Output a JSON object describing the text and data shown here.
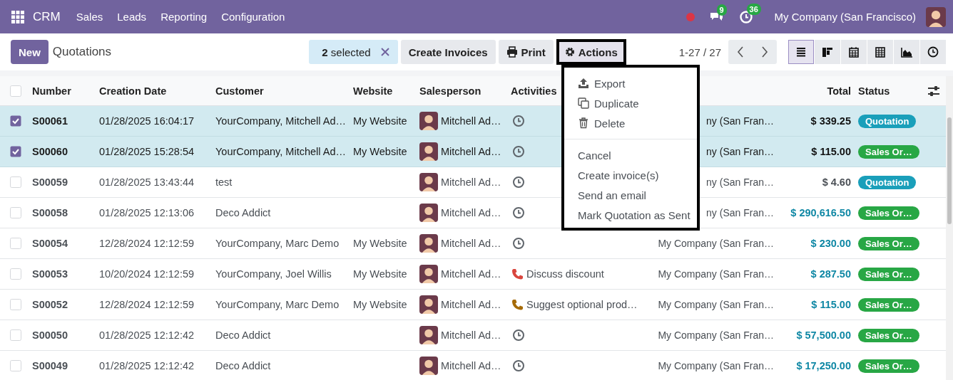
{
  "navbar": {
    "app": "CRM",
    "menus": [
      "Sales",
      "Leads",
      "Reporting",
      "Configuration"
    ],
    "messages_count": "9",
    "activities_count": "36",
    "company": "My Company (San Francisco)"
  },
  "control_panel": {
    "new_button": "New",
    "breadcrumb": "Quotations",
    "selection": "**2** selected",
    "buttons": [
      "Create Invoices",
      "Print",
      "Actions"
    ],
    "pager": "1-27 / 27",
    "views": [
      {
        "kind": "list",
        "selected": true
      },
      {
        "kind": "kanban",
        "selected": false
      },
      {
        "kind": "calendar",
        "selected": false
      },
      {
        "kind": "pivot",
        "selected": false
      },
      {
        "kind": "graph",
        "selected": false
      },
      {
        "kind": "activity",
        "selected": false
      }
    ]
  },
  "actions_menu": {
    "groups": [
      [
        {
          "kind": "export",
          "label": "Export"
        },
        {
          "kind": "duplicate",
          "label": "Duplicate"
        },
        {
          "kind": "delete",
          "label": "Delete"
        }
      ],
      [
        {
          "kind": "text",
          "label": "Cancel"
        },
        {
          "kind": "text",
          "label": "Create invoice(s)"
        },
        {
          "kind": "text",
          "label": "Send an email"
        },
        {
          "kind": "text",
          "label": "Mark Quotation as Sent"
        }
      ]
    ]
  },
  "table": {
    "all_selected": false,
    "columns": [
      "Number",
      "Creation Date",
      "Customer",
      "Website",
      "Salesperson",
      "Activities",
      "Total",
      "Status"
    ],
    "rows": [
      {
        "selected": true,
        "number": "S00061",
        "date": "01/28/2025 16:04:17",
        "customer": "YourCompany, Mitchell Ad…",
        "website": "My Website",
        "salesperson": "Mitchell Ad…",
        "activity": {
          "kind": "clock"
        },
        "company": "ny (San Fran…",
        "total": "$ 339.25",
        "status": {
          "kind": "quotation",
          "label": "Quotation"
        }
      },
      {
        "selected": true,
        "number": "S00060",
        "date": "01/28/2025 15:28:54",
        "customer": "YourCompany, Mitchell Ad…",
        "website": "My Website",
        "salesperson": "Mitchell Ad…",
        "activity": {
          "kind": "clock"
        },
        "company": "ny (San Fran…",
        "total": "$ 115.00",
        "status": {
          "kind": "sale",
          "label": "Sales Or…"
        }
      },
      {
        "selected": false,
        "number": "S00059",
        "date": "01/28/2025 13:43:44",
        "customer": "test",
        "salesperson": "Mitchell Ad…",
        "activity": {
          "kind": "clock"
        },
        "company": "ny (San Fran…",
        "total": "$ 4.60",
        "status": {
          "kind": "quotation",
          "label": "Quotation"
        }
      },
      {
        "selected": false,
        "number": "S00058",
        "date": "01/28/2025 12:13:06",
        "customer": "Deco Addict",
        "salesperson": "Mitchell Ad…",
        "activity": {
          "kind": "clock"
        },
        "company": "ny (San Fran…",
        "total": "$ 290,616.50",
        "status": {
          "kind": "sale",
          "label": "Sales Or…"
        }
      },
      {
        "selected": false,
        "number": "S00054",
        "date": "12/28/2024 12:12:59",
        "customer": "YourCompany, Marc Demo",
        "website": "My Website",
        "salesperson": "Mitchell Ad…",
        "activity": {
          "kind": "clock"
        },
        "company": "My Company (San Fran…",
        "total": "$ 230.00",
        "status": {
          "kind": "sale",
          "label": "Sales Or…"
        }
      },
      {
        "selected": false,
        "number": "S00053",
        "date": "10/20/2024 12:12:59",
        "customer": "YourCompany, Joel Willis",
        "website": "My Website",
        "salesperson": "Mitchell Ad…",
        "activity": {
          "kind": "phone",
          "color": "#d9463e",
          "text": "Discuss discount"
        },
        "company": "My Company (San Fran…",
        "total": "$ 287.50",
        "status": {
          "kind": "sale",
          "label": "Sales Or…"
        }
      },
      {
        "selected": false,
        "number": "S00052",
        "date": "12/28/2024 12:12:59",
        "customer": "YourCompany, Marc Demo",
        "website": "My Website",
        "salesperson": "Mitchell Ad…",
        "activity": {
          "kind": "phone",
          "color": "#a66b08",
          "text": "Suggest optional prod…"
        },
        "company": "My Company (San Fran…",
        "total": "$ 115.00",
        "status": {
          "kind": "sale",
          "label": "Sales Or…"
        }
      },
      {
        "selected": false,
        "number": "S00050",
        "date": "01/28/2025 12:12:42",
        "customer": "Deco Addict",
        "salesperson": "Mitchell Ad…",
        "activity": {
          "kind": "clock"
        },
        "company": "My Company (San Fran…",
        "total": "$ 57,500.00",
        "status": {
          "kind": "sale",
          "label": "Sales Or…"
        }
      },
      {
        "selected": false,
        "number": "S00049",
        "date": "01/28/2025 12:12:42",
        "customer": "Deco Addict",
        "salesperson": "Mitchell Ad…",
        "activity": {
          "kind": "clock"
        },
        "company": "My Company (San Fran…",
        "total": "$ 17,250.00",
        "status": {
          "kind": "sale",
          "label": "Sales Or…"
        }
      }
    ]
  }
}
